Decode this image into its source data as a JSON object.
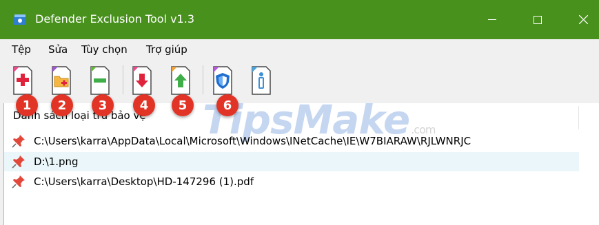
{
  "window": {
    "title": "Defender Exclusion Tool v1.3"
  },
  "menu": {
    "items": [
      {
        "label": "Tệp"
      },
      {
        "label": "Sửa"
      },
      {
        "label": "Tùy chọn"
      },
      {
        "label": "Trợ giúp"
      }
    ]
  },
  "toolbar": {
    "badges": [
      "1",
      "2",
      "3",
      "4",
      "5",
      "6"
    ]
  },
  "list": {
    "column_header": "Danh sách loại trừ bảo vệ",
    "rows": [
      {
        "path": "C:\\Users\\karra\\AppData\\Local\\Microsoft\\Windows\\INetCache\\IE\\W7BIARAW\\RJLWNRJC"
      },
      {
        "path": "D:\\1.png"
      },
      {
        "path": "C:\\Users\\karra\\Desktop\\HD-147296 (1).pdf"
      }
    ]
  },
  "watermark": {
    "text": "TipsMake",
    "suffix": ".com"
  },
  "colors": {
    "titlebar": "#48911c",
    "badge": "#e23426",
    "selected_row": "#ebf6fa"
  }
}
